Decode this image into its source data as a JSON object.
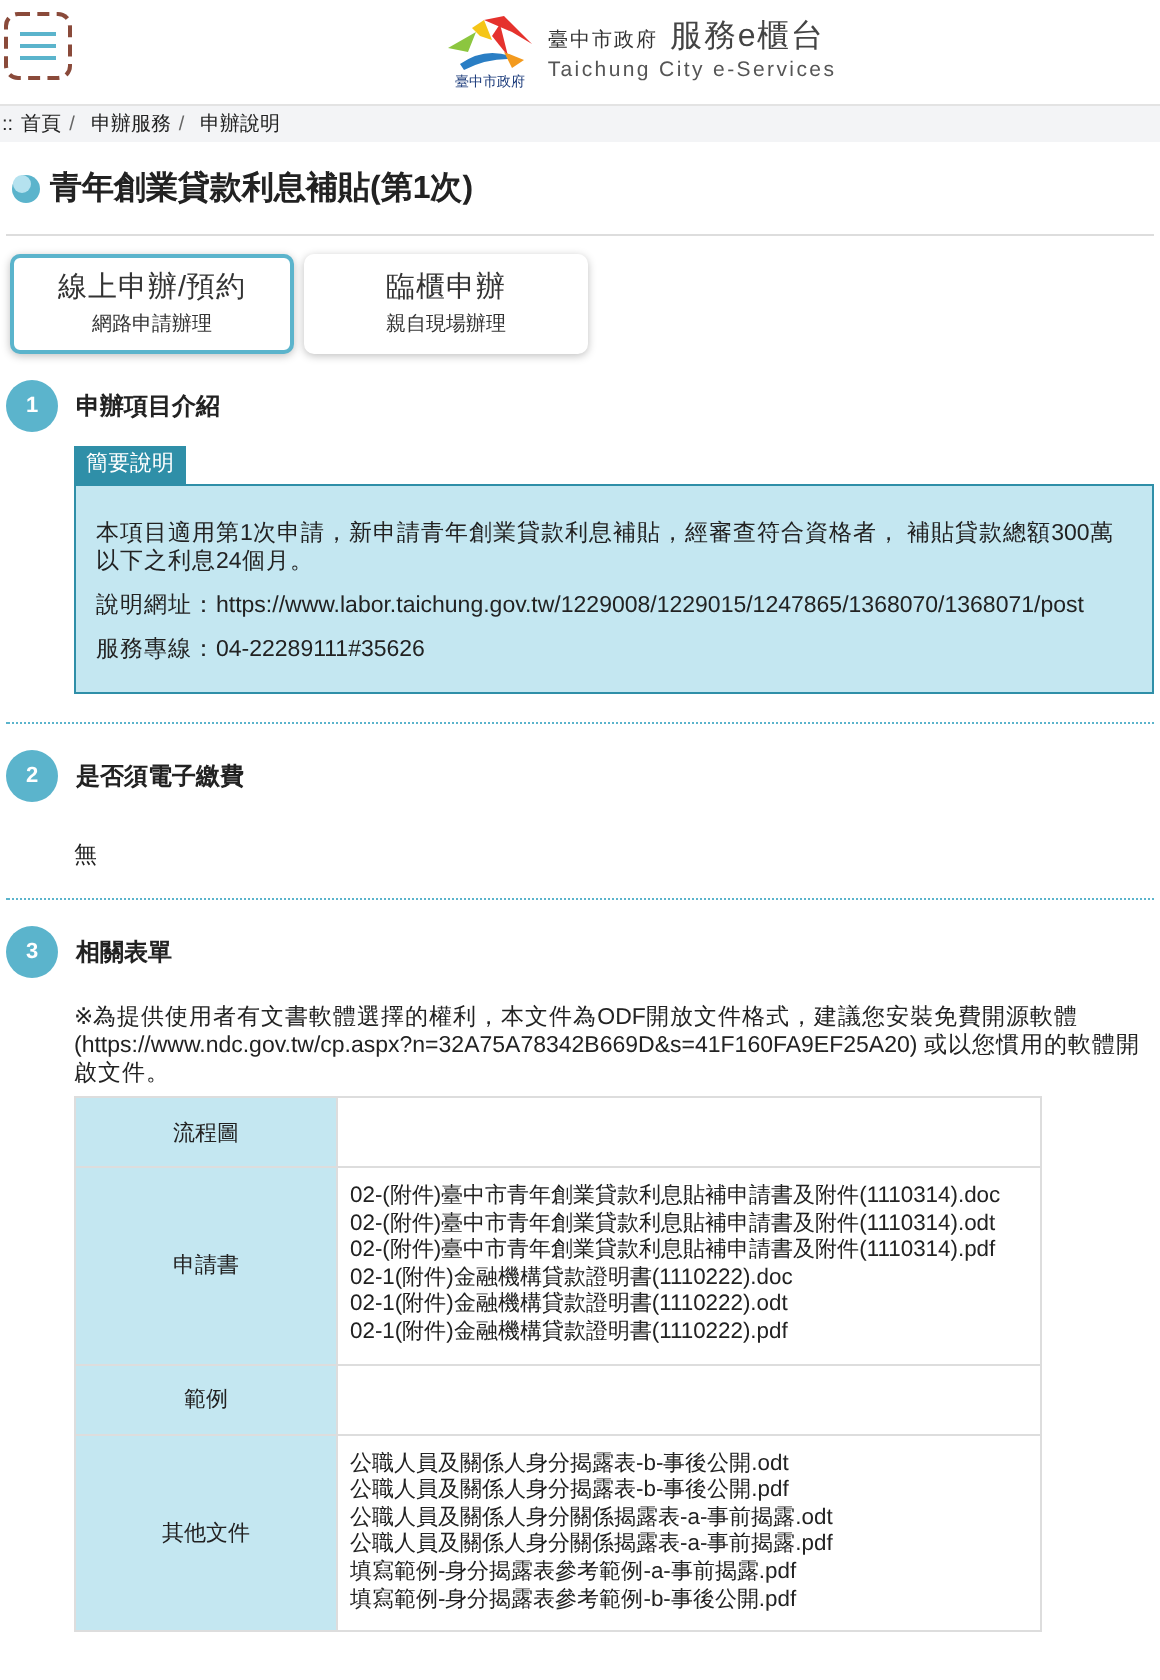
{
  "header": {
    "logo_caption": "臺中市政府",
    "org": "臺中市政府",
    "title": "服務e櫃台",
    "subtitle": "Taichung City e-Services"
  },
  "breadcrumb": {
    "marker": "::",
    "separator": "/",
    "items": [
      "首頁",
      "申辦服務",
      "申辦說明"
    ]
  },
  "page_title": "青年創業貸款利息補貼(第1次)",
  "tabs": [
    {
      "label": "線上申辦/預約",
      "sublabel": "網路申請辦理",
      "selected": true
    },
    {
      "label": "臨櫃申辦",
      "sublabel": "親自現場辦理",
      "selected": false
    }
  ],
  "sections": [
    {
      "number": "1",
      "heading": "申辦項目介紹",
      "kind": "summary",
      "box_label": "簡要說明",
      "paragraphs": [
        "本項目適用第1次申請，新申請青年創業貸款利息補貼，經審查符合資格者， 補貼貸款總額300萬以下之利息24個月。",
        "說明網址：https://www.labor.taichung.gov.tw/1229008/1229015/1247865/1368070/1368071/post",
        "服務專線：04-22289111#35626"
      ]
    },
    {
      "number": "2",
      "heading": "是否須電子繳費",
      "kind": "text",
      "text": "無"
    },
    {
      "number": "3",
      "heading": "相關表單",
      "kind": "forms",
      "note": "※為提供使用者有文書軟體選擇的權利，本文件為ODF開放文件格式，建議您安裝免費開源軟體(https://www.ndc.gov.tw/cp.aspx?n=32A75A78342B669D&s=41F160FA9EF25A20) 或以您慣用的軟體開啟文件。",
      "rows": [
        {
          "label": "流程圖"
        },
        {
          "label": "申請書",
          "files": [
            "02-(附件)臺中市青年創業貸款利息貼補申請書及附件(1110314).doc",
            "02-(附件)臺中市青年創業貸款利息貼補申請書及附件(1110314).odt",
            "02-(附件)臺中市青年創業貸款利息貼補申請書及附件(1110314).pdf",
            "02-1(附件)金融機構貸款證明書(1110222).doc",
            "02-1(附件)金融機構貸款證明書(1110222).odt",
            "02-1(附件)金融機構貸款證明書(1110222).pdf"
          ]
        },
        {
          "label": "範例"
        },
        {
          "label": "其他文件",
          "files": [
            "公職人員及關係人身分揭露表-b-事後公開.odt",
            "公職人員及關係人身分揭露表-b-事後公開.pdf",
            "公職人員及關係人身分關係揭露表-a-事前揭露.odt",
            "公職人員及關係人身分關係揭露表-a-事前揭露.pdf",
            "填寫範例-身分揭露表參考範例-a-事前揭露.pdf",
            "填寫範例-身分揭露表參考範例-b-事後公開.pdf"
          ]
        }
      ]
    }
  ]
}
